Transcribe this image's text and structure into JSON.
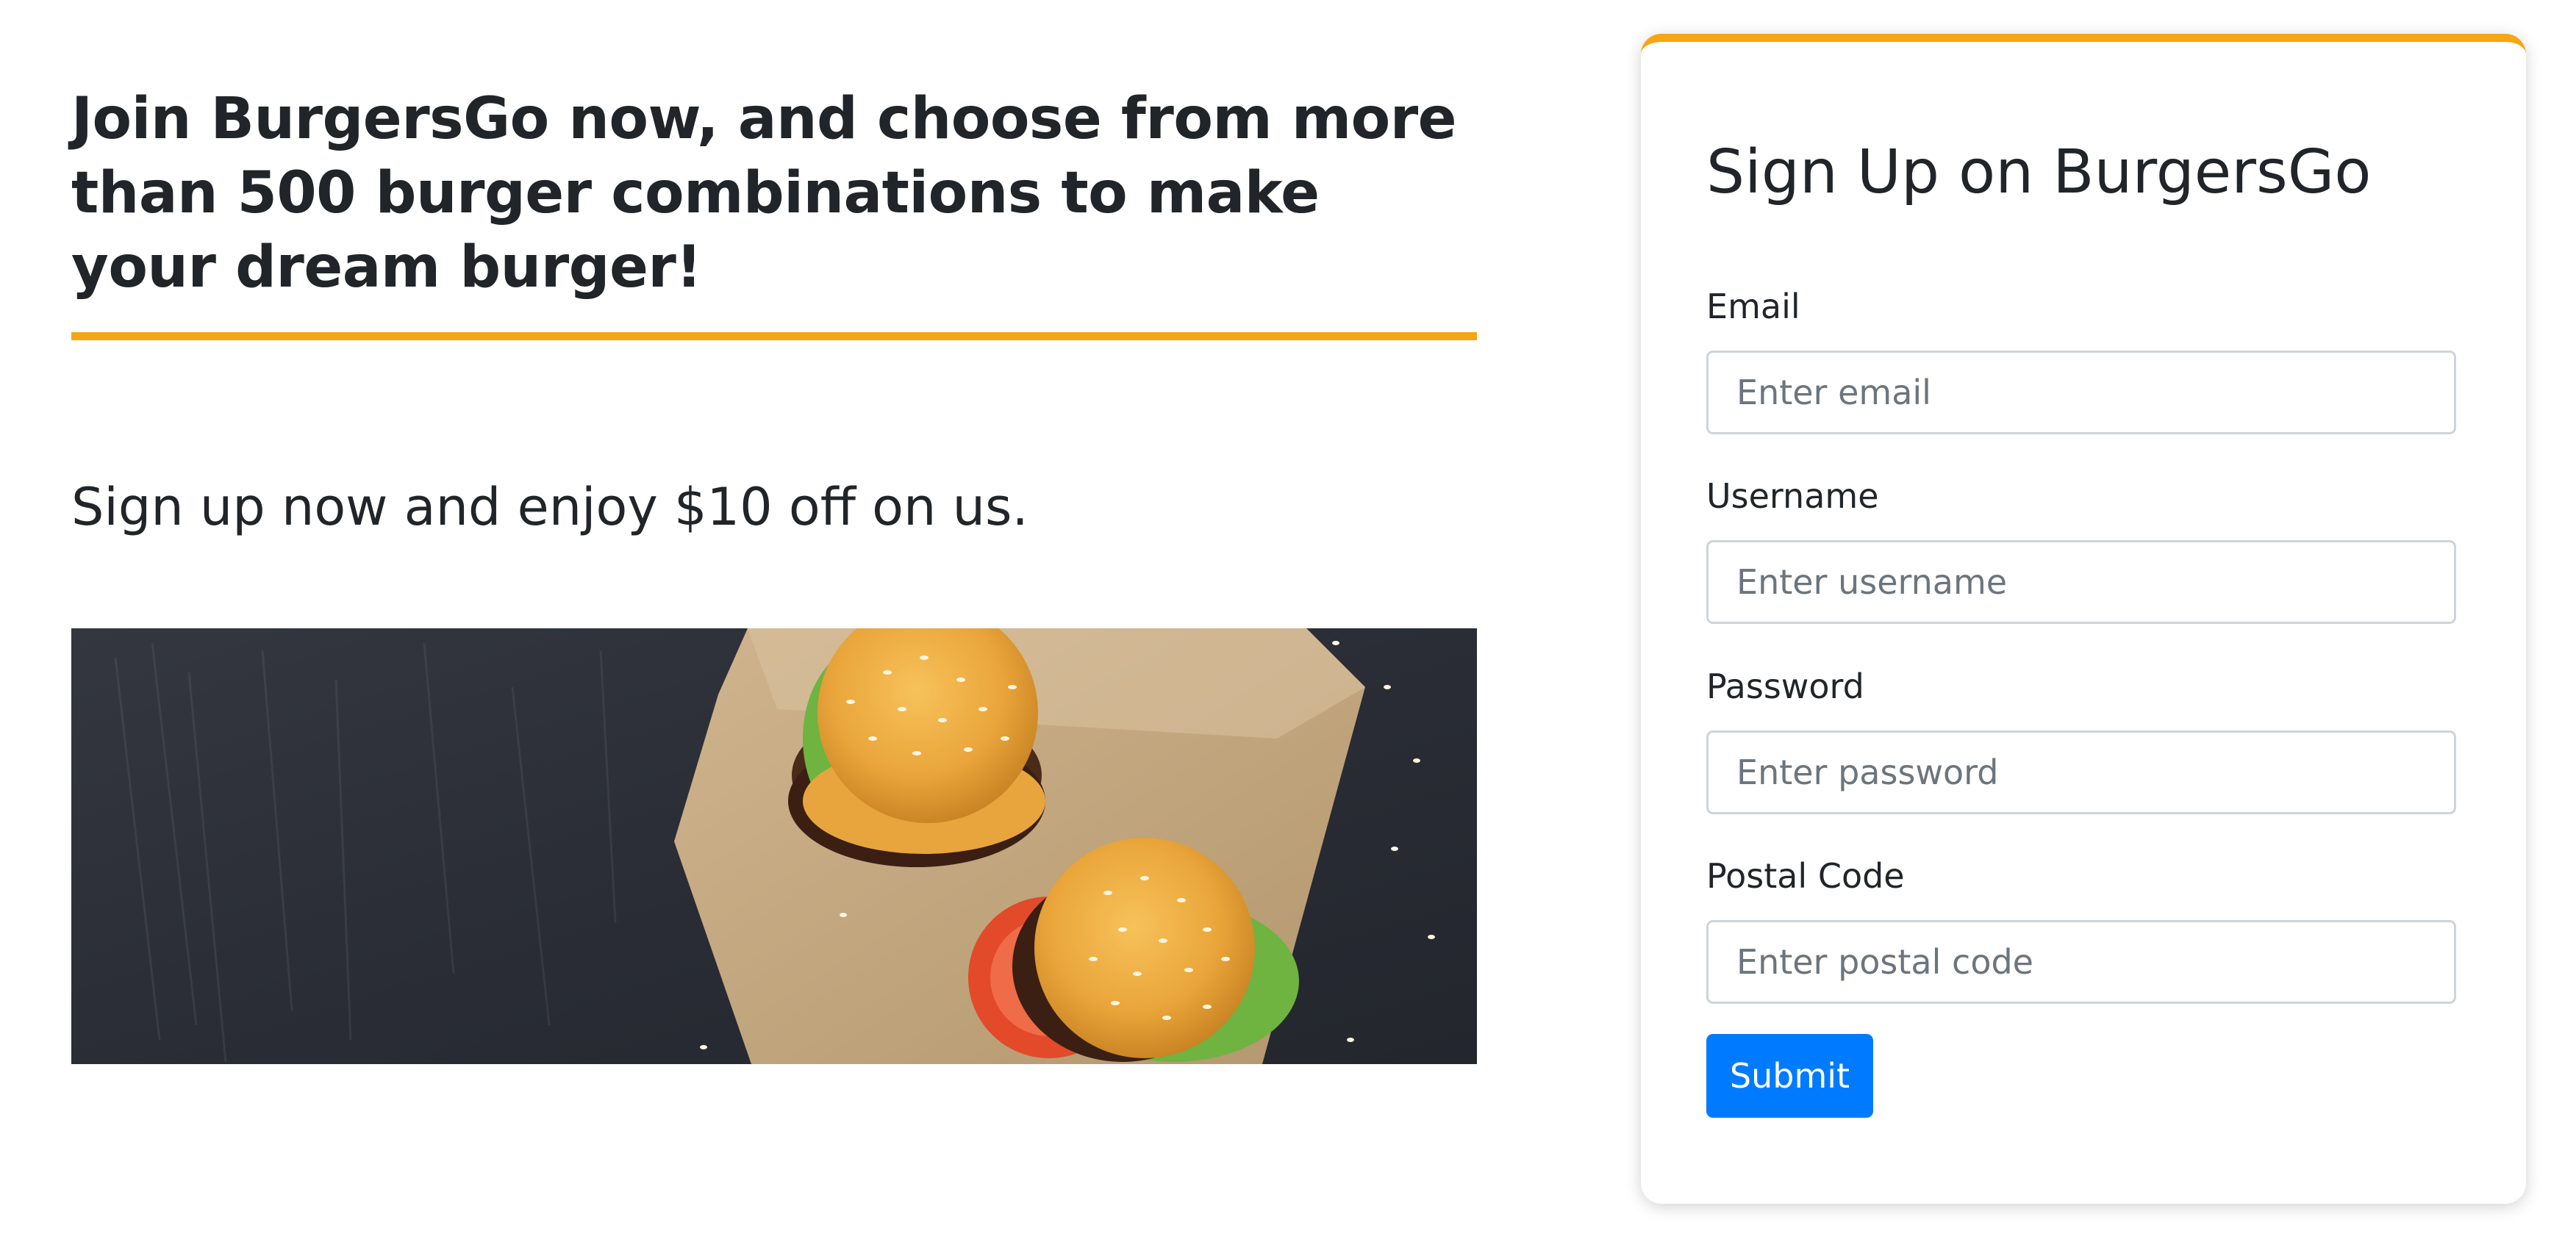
{
  "hero": {
    "headline": "Join BurgersGo now, and choose from more than 500 burger combinations to make your dream burger!",
    "subtext": "Sign up now and enjoy $10 off on us.",
    "accent_color": "#f5a614"
  },
  "signup": {
    "title": "Sign Up on BurgersGo",
    "fields": [
      {
        "label": "Email",
        "placeholder": "Enter email"
      },
      {
        "label": "Username",
        "placeholder": "Enter username"
      },
      {
        "label": "Password",
        "placeholder": "Enter password"
      },
      {
        "label": "Postal Code",
        "placeholder": "Enter postal code"
      }
    ],
    "submit_label": "Submit",
    "submit_color": "#007bff"
  }
}
